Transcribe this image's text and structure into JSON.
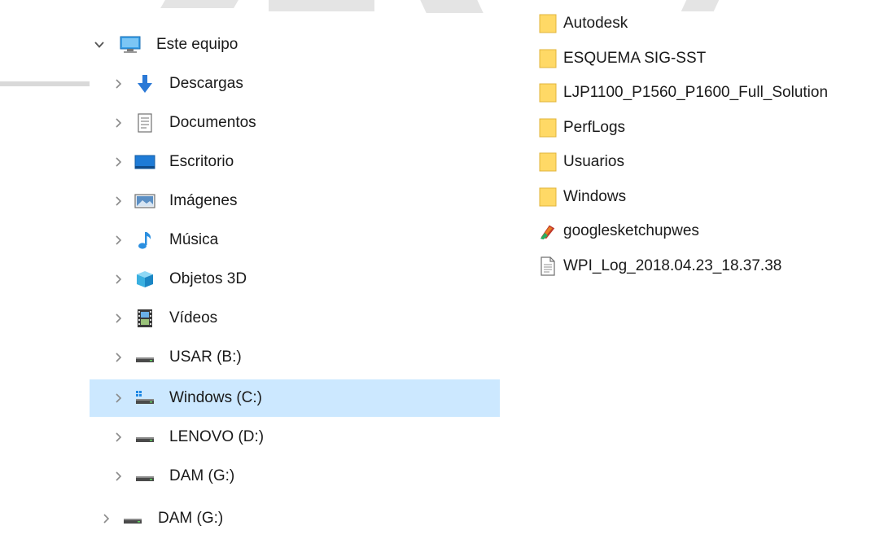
{
  "navigation": {
    "root": {
      "label": "Este equipo",
      "icon": "computer-icon",
      "expanded": true
    },
    "items": [
      {
        "label": "Descargas",
        "icon": "download-arrow-icon"
      },
      {
        "label": "Documentos",
        "icon": "document-icon"
      },
      {
        "label": "Escritorio",
        "icon": "desktop-icon"
      },
      {
        "label": "Imágenes",
        "icon": "pictures-icon"
      },
      {
        "label": "Música",
        "icon": "music-note-icon"
      },
      {
        "label": "Objetos 3D",
        "icon": "cube-3d-icon"
      },
      {
        "label": "Vídeos",
        "icon": "film-icon"
      },
      {
        "label": "USAR (B:)",
        "icon": "drive-icon"
      },
      {
        "label": "Windows (C:)",
        "icon": "windows-drive-icon",
        "selected": true
      },
      {
        "label": "LENOVO (D:)",
        "icon": "drive-icon"
      },
      {
        "label": "DAM (G:)",
        "icon": "drive-icon"
      }
    ],
    "outer_item": {
      "label": "DAM (G:)",
      "icon": "drive-icon"
    },
    "selected_color": "#cce8ff"
  },
  "file_list": {
    "items": [
      {
        "name": "Autodesk",
        "type": "folder",
        "icon": "folder-icon"
      },
      {
        "name": "ESQUEMA SIG-SST",
        "type": "folder",
        "icon": "folder-icon"
      },
      {
        "name": "LJP1100_P1560_P1600_Full_Solution",
        "type": "folder",
        "icon": "folder-icon"
      },
      {
        "name": "PerfLogs",
        "type": "folder",
        "icon": "folder-icon"
      },
      {
        "name": "Usuarios",
        "type": "folder",
        "icon": "folder-icon"
      },
      {
        "name": "Windows",
        "type": "folder",
        "icon": "folder-icon"
      },
      {
        "name": "googlesketchupwes",
        "type": "application",
        "icon": "sketchup-app-icon"
      },
      {
        "name": "WPI_Log_2018.04.23_18.37.38",
        "type": "text",
        "icon": "text-file-icon"
      }
    ],
    "folder_color": "#ffd966"
  }
}
